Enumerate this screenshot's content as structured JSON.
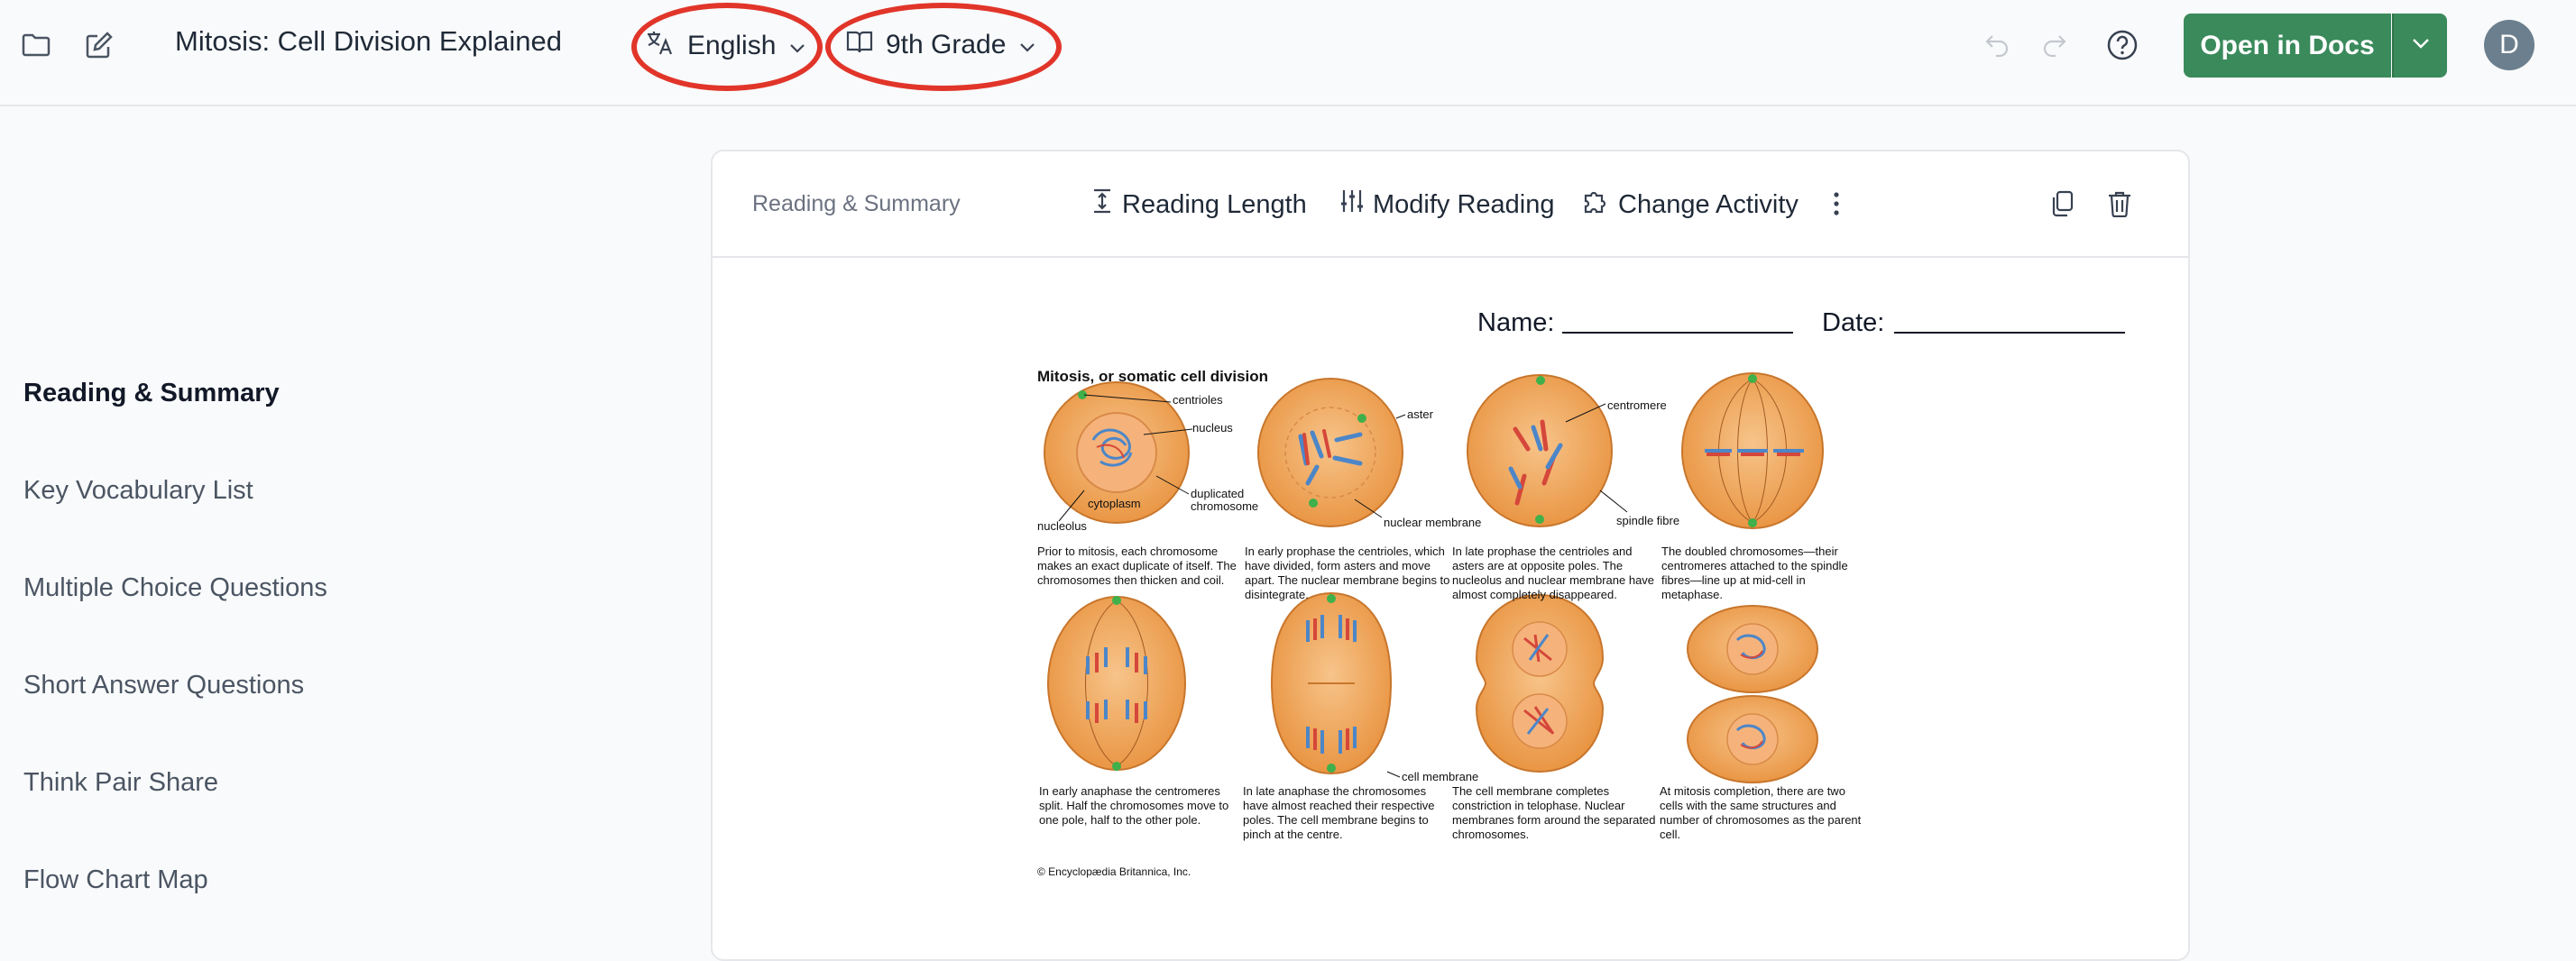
{
  "header": {
    "title": "Mitosis: Cell Division Explained",
    "language": "English",
    "grade": "9th Grade",
    "open_label": "Open in Docs",
    "avatar_initial": "D"
  },
  "sidebar": {
    "items": [
      {
        "label": "Reading & Summary",
        "active": true
      },
      {
        "label": "Key Vocabulary List"
      },
      {
        "label": "Multiple Choice Questions"
      },
      {
        "label": "Short Answer Questions"
      },
      {
        "label": "Think Pair Share"
      },
      {
        "label": "Flow Chart Map"
      }
    ]
  },
  "card": {
    "label": "Reading & Summary",
    "tools": [
      "Reading Length",
      "Modify Reading",
      "Change Activity"
    ],
    "name_label": "Name:",
    "date_label": "Date:"
  },
  "figure": {
    "title": "Mitosis, or somatic cell division",
    "labels": {
      "centrioles": "centrioles",
      "nucleus": "nucleus",
      "duplicated": "duplicated",
      "chromosome": "chromosome",
      "cytoplasm": "cytoplasm",
      "nucleolus": "nucleolus",
      "aster": "aster",
      "nuclear_membrane": "nuclear membrane",
      "centromere": "centromere",
      "spindle_fibre": "spindle fibre",
      "cell_membrane": "cell membrane"
    },
    "captions": [
      "Prior to mitosis, each chromosome makes an exact duplicate of itself. The chromosomes then thicken and coil.",
      "In early prophase the centrioles, which have divided, form asters and move apart. The nuclear membrane begins to disintegrate.",
      "In late prophase the centrioles and asters are at opposite poles. The nucleolus and nuclear membrane have almost completely disappeared.",
      "The doubled chromosomes—their centromeres attached to the spindle fibres—line up at mid-cell in metaphase.",
      "In early anaphase the centromeres split. Half the chromosomes move to one pole, half to the other pole.",
      "In late anaphase the chromosomes have almost reached their respective poles. The cell membrane begins to pinch at the centre.",
      "The cell membrane completes constriction in telophase. Nuclear membranes form around the separated chromosomes.",
      "At mitosis completion, there are two cells with the same structures and number of chromosomes as the parent cell."
    ],
    "copyright": "© Encyclopædia Britannica, Inc."
  },
  "colors": {
    "accent": "#3a8a5b",
    "highlight_ring": "#e1352a",
    "cell_fill": "#f0a55a"
  }
}
